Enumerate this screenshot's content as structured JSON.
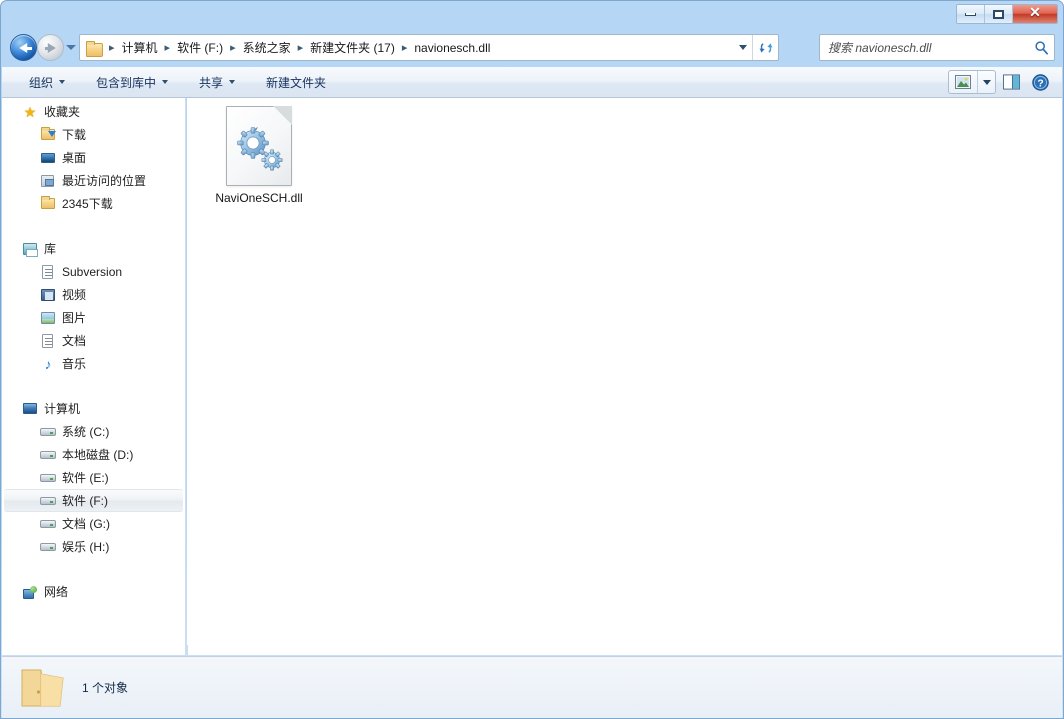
{
  "window": {
    "title": "",
    "caption_buttons": [
      {
        "name": "minimize",
        "label": "–"
      },
      {
        "name": "maximize",
        "label": "□"
      },
      {
        "name": "close",
        "label": "✕"
      }
    ]
  },
  "navigation": {
    "back_tooltip": "后退",
    "forward_tooltip": "前进",
    "breadcrumb": [
      "计算机",
      "软件 (F:)",
      "系统之家",
      "新建文件夹 (17)",
      "navionesch.dll"
    ],
    "separator": "▸",
    "refresh_icon": "refresh-icon",
    "dropdown_icon": "chevron-down-icon"
  },
  "search": {
    "placeholder": "搜索 navionesch.dll",
    "value": "",
    "icon": "search-icon"
  },
  "toolbar": {
    "items": [
      {
        "label": "组织",
        "has_caret": true
      },
      {
        "label": "包含到库中",
        "has_caret": true
      },
      {
        "label": "共享",
        "has_caret": true
      },
      {
        "label": "新建文件夹",
        "has_caret": false
      }
    ],
    "view_button": "change-view-button",
    "preview_pane_button": "preview-pane-button",
    "help_button": "help-button"
  },
  "sidebar": {
    "groups": [
      {
        "root": {
          "label": "收藏夹",
          "icon": "star-icon"
        },
        "children": [
          {
            "label": "下载",
            "icon": "download-folder-icon"
          },
          {
            "label": "桌面",
            "icon": "desktop-icon"
          },
          {
            "label": "最近访问的位置",
            "icon": "recent-places-icon"
          },
          {
            "label": "2345下载",
            "icon": "folder-icon"
          }
        ]
      },
      {
        "root": {
          "label": "库",
          "icon": "library-icon"
        },
        "children": [
          {
            "label": "Subversion",
            "icon": "document-icon"
          },
          {
            "label": "视频",
            "icon": "video-icon"
          },
          {
            "label": "图片",
            "icon": "picture-icon"
          },
          {
            "label": "文档",
            "icon": "document-icon"
          },
          {
            "label": "音乐",
            "icon": "music-icon"
          }
        ]
      },
      {
        "root": {
          "label": "计算机",
          "icon": "computer-icon"
        },
        "children": [
          {
            "label": "系统 (C:)",
            "icon": "drive-icon",
            "selected": false
          },
          {
            "label": "本地磁盘 (D:)",
            "icon": "drive-icon",
            "selected": false
          },
          {
            "label": "软件 (E:)",
            "icon": "drive-icon",
            "selected": false
          },
          {
            "label": "软件 (F:)",
            "icon": "drive-icon",
            "selected": true
          },
          {
            "label": "文档 (G:)",
            "icon": "drive-icon",
            "selected": false
          },
          {
            "label": "娱乐 (H:)",
            "icon": "drive-icon",
            "selected": false
          }
        ]
      },
      {
        "root": {
          "label": "网络",
          "icon": "network-icon"
        },
        "children": []
      }
    ]
  },
  "files": [
    {
      "name": "NaviOneSCH.dll",
      "icon": "dll-gears-icon",
      "selected": false
    }
  ],
  "statusbar": {
    "icon": "open-folder-icon",
    "text": "1 个对象"
  },
  "colors": {
    "title_bar": "#b4d5f5",
    "accent_blue": "#2d7fd4",
    "close_red": "#c33b26",
    "selection_gray": "#e9eef3",
    "pane_border": "#cddded"
  }
}
